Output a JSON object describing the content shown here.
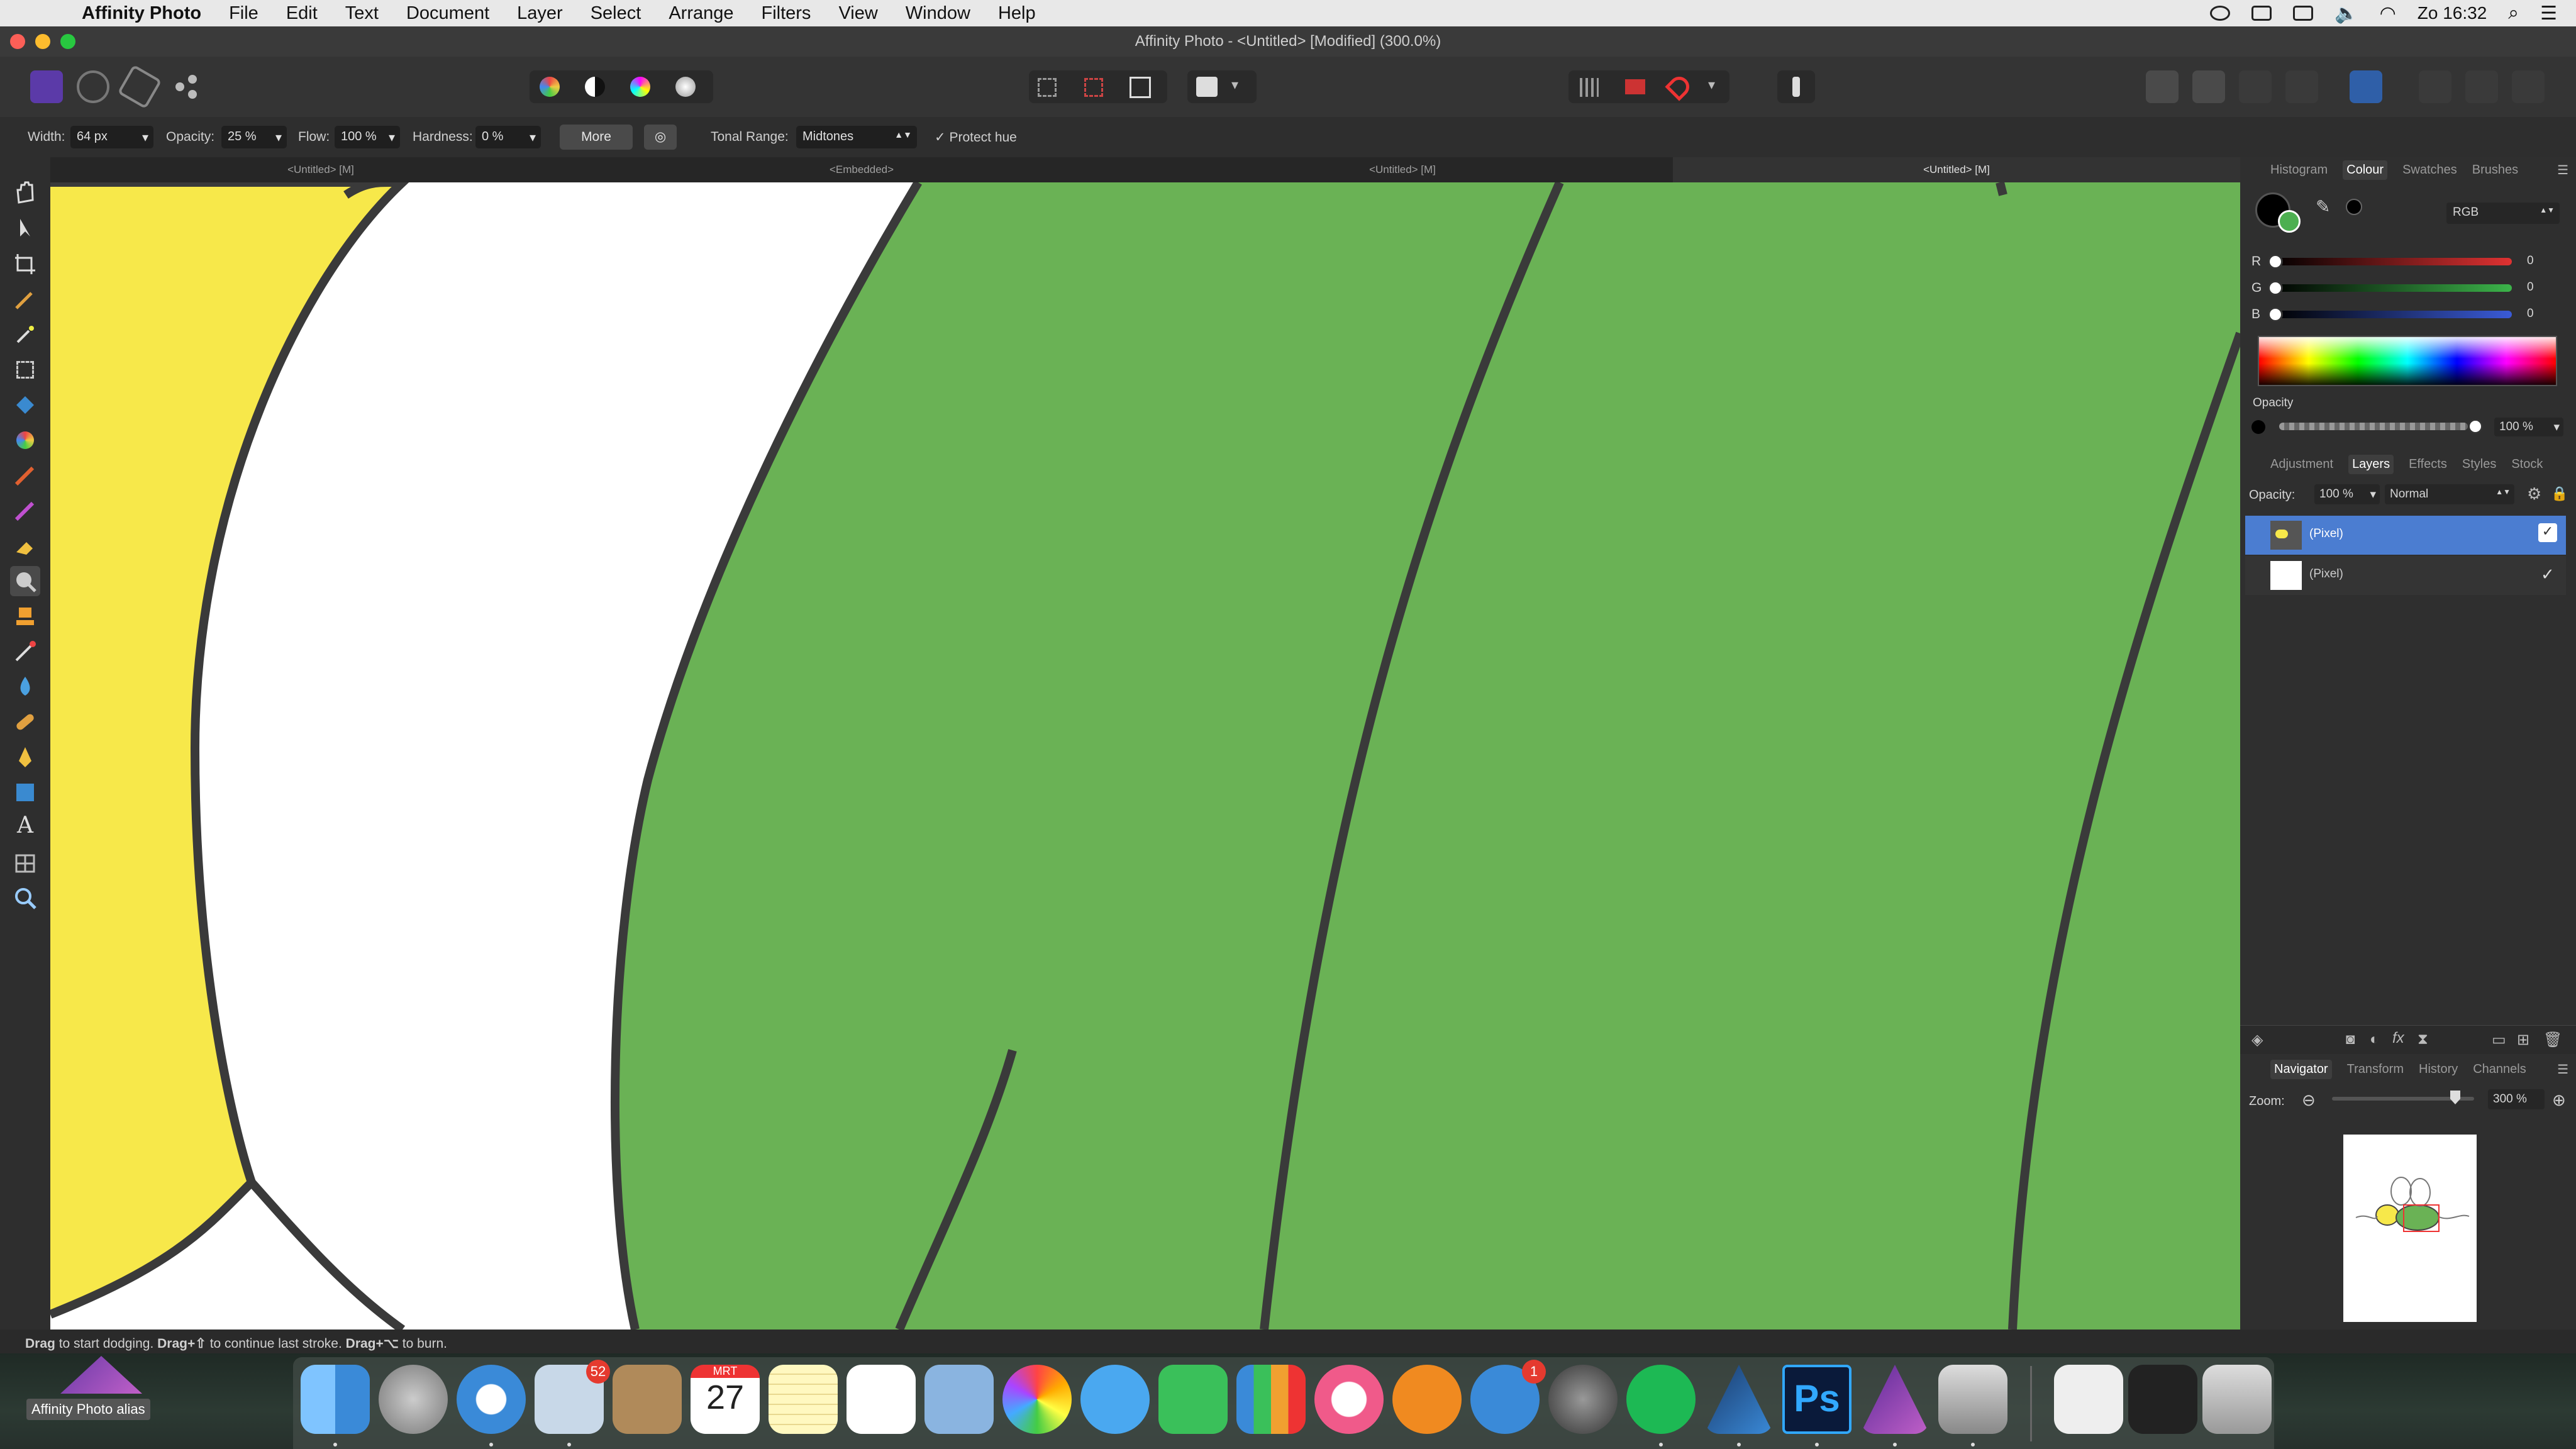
{
  "menubar": {
    "app_name": "Affinity Photo",
    "items": [
      "File",
      "Edit",
      "Text",
      "Document",
      "Layer",
      "Select",
      "Arrange",
      "Filters",
      "View",
      "Window",
      "Help"
    ],
    "clock": "Zo 16:32"
  },
  "window": {
    "title": "Affinity Photo - <Untitled> [Modified] (300.0%)"
  },
  "context_toolbar": {
    "width_label": "Width:",
    "width_value": "64 px",
    "opacity_label": "Opacity:",
    "opacity_value": "25 %",
    "flow_label": "Flow:",
    "flow_value": "100 %",
    "hardness_label": "Hardness:",
    "hardness_value": "0 %",
    "more_label": "More",
    "tonal_range_label": "Tonal Range:",
    "tonal_range_value": "Midtones",
    "protect_hue_label": "Protect hue",
    "protect_hue_checked": true
  },
  "doc_tabs": [
    "<Untitled> [M]",
    "<Embedded>",
    "<Untitled> [M]",
    "<Untitled> [M]"
  ],
  "colour_panel": {
    "tabs": [
      "Histogram",
      "Colour",
      "Swatches",
      "Brushes"
    ],
    "active_tab": "Colour",
    "mode": "RGB",
    "channels": [
      {
        "label": "R",
        "value": "0",
        "color": "#e03232"
      },
      {
        "label": "G",
        "value": "0",
        "color": "#3cb44a"
      },
      {
        "label": "B",
        "value": "0",
        "color": "#3a5bd8"
      }
    ],
    "opacity_label": "Opacity",
    "opacity_value": "100 %"
  },
  "layers_panel": {
    "tabs": [
      "Adjustment",
      "Layers",
      "Effects",
      "Styles",
      "Stock"
    ],
    "active_tab": "Layers",
    "opacity_label": "Opacity:",
    "opacity_value": "100 %",
    "blend_mode": "Normal",
    "layers": [
      {
        "name": "(Pixel)",
        "selected": true
      },
      {
        "name": "(Pixel)",
        "selected": false
      }
    ]
  },
  "navigator_panel": {
    "tabs": [
      "Navigator",
      "Transform",
      "History",
      "Channels"
    ],
    "active_tab": "Navigator",
    "zoom_label": "Zoom:",
    "zoom_value": "300 %"
  },
  "status_hint": {
    "part1_bold": "Drag",
    "part1": " to start dodging. ",
    "part2_bold": "Drag+⇧",
    "part2": " to continue last stroke. ",
    "part3_bold": "Drag+⌥",
    "part3": " to burn."
  },
  "desktop": {
    "alias_label": "Affinity Photo alias"
  },
  "dock": {
    "mail_badge": "52",
    "calendar_month": "MRT",
    "calendar_day": "27",
    "appstore_badge": "1",
    "photoshop_label": "Ps"
  },
  "colors": {
    "canvas_green": "#6ab255",
    "canvas_yellow": "#f7e84a",
    "selection_blue": "#4b7dd1",
    "panel_bg": "#2f2f2f"
  }
}
